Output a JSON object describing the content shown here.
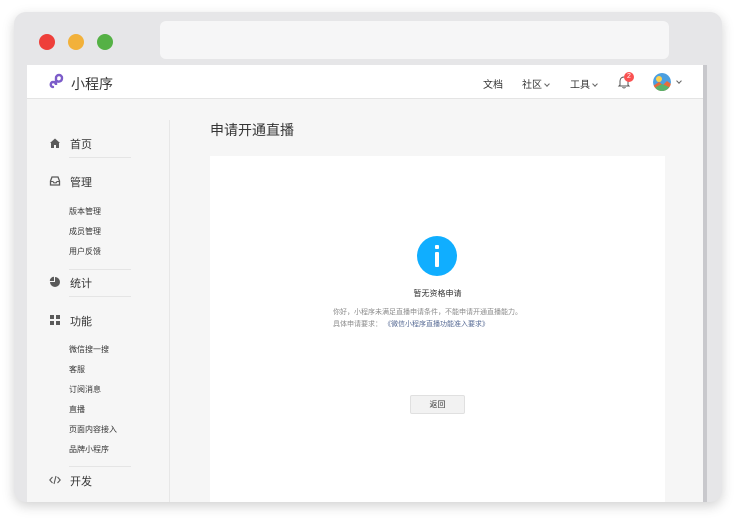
{
  "app": {
    "brand": "小程序",
    "accent_color": "#10aeff",
    "link_color": "#576b95"
  },
  "topbar": {
    "nav": [
      {
        "label": "文档",
        "has_dropdown": false
      },
      {
        "label": "社区",
        "has_dropdown": true
      },
      {
        "label": "工具",
        "has_dropdown": true
      }
    ],
    "notification_count": "2",
    "notification_icon": "bell-icon",
    "avatar_icon": "avatar"
  },
  "sidebar": {
    "groups": [
      {
        "label": "首页",
        "icon": "home-icon",
        "items": []
      },
      {
        "label": "管理",
        "icon": "inbox-icon",
        "items": [
          "版本管理",
          "成员管理",
          "用户反馈"
        ]
      },
      {
        "label": "统计",
        "icon": "pie-chart-icon",
        "items": []
      },
      {
        "label": "功能",
        "icon": "grid-icon",
        "items": [
          "微信搜一搜",
          "客服",
          "订阅消息",
          "直播",
          "页面内容接入",
          "品牌小程序"
        ]
      },
      {
        "label": "开发",
        "icon": "code-icon",
        "items": []
      }
    ]
  },
  "main": {
    "title": "申请开通直播",
    "status_title": "暂无资格申请",
    "status_desc": "你好，小程序未满足直播申请条件，不能申请开通直播能力。",
    "req_prefix": "具体申请要求：",
    "req_link": "《微信小程序直播功能准入要求》",
    "back_label": "返回"
  }
}
